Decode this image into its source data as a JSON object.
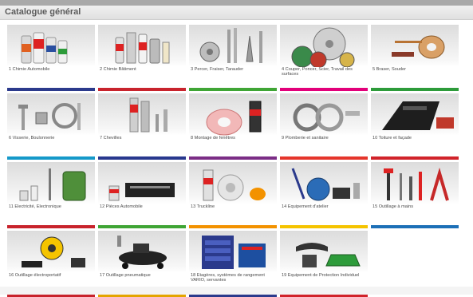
{
  "header": {
    "title": "Catalogue général"
  },
  "colors": {
    "header_bg": "#e6e6e6",
    "bars": [
      "#c62828",
      "#2e7d32",
      "#7cb342",
      "#8bc34a",
      "#e8e840",
      "#e53935",
      "#1a237e",
      "#26a69a",
      "#f9a825",
      "#fb8c00",
      "#c62828",
      "#1565c0",
      "#c62828",
      "#283593",
      "#c62828",
      "#283593",
      "#e53935",
      "#7b1fa2",
      "#1565c0"
    ]
  },
  "tiles": [
    {
      "label": "1 Chimie Automobile",
      "bar": "#2b3a8c",
      "icon": "spray-cans-icon"
    },
    {
      "label": "2 Chimie Bâtiment",
      "bar": "#c8232c",
      "icon": "cartridges-icon"
    },
    {
      "label": "3 Percer, Fraiser, Tarauder",
      "bar": "#3fa535",
      "icon": "drill-bits-icon"
    },
    {
      "label": "4 Couper, Poncer, Scier, Travail des surfaces",
      "bar": "#e2007a",
      "icon": "saw-blade-icon"
    },
    {
      "label": "5 Braser, Souder",
      "bar": "#2d9b3a",
      "icon": "solder-wire-icon"
    },
    {
      "label": "6 Visserie, Boulonnerie",
      "bar": "#1599c9",
      "icon": "screws-icon"
    },
    {
      "label": "7 Chevilles",
      "bar": "#28388e",
      "icon": "anchors-icon"
    },
    {
      "label": "8 Montage de fenêtres",
      "bar": "#7b2d86",
      "icon": "window-tape-icon"
    },
    {
      "label": "9 Plomberie et sanitaire",
      "bar": "#e5352b",
      "icon": "plumbing-hose-icon"
    },
    {
      "label": "10 Toiture et façade",
      "bar": "#d1232a",
      "icon": "roofing-icon"
    },
    {
      "label": "11 Electricité, Electronique",
      "bar": "#c8232c",
      "icon": "cable-reel-icon"
    },
    {
      "label": "12 Pièces Automobile",
      "bar": "#3fa535",
      "icon": "car-parts-icon"
    },
    {
      "label": "13 Truckline",
      "bar": "#f39200",
      "icon": "truck-parts-icon"
    },
    {
      "label": "14 Equipement d'atelier",
      "bar": "#f5c400",
      "icon": "workshop-equipment-icon"
    },
    {
      "label": "15 Outillage à mains",
      "bar": "#1d70b7",
      "icon": "hand-tools-icon"
    },
    {
      "label": "16 Outillage électroportatif",
      "bar": "#c8232c",
      "icon": "power-tools-icon"
    },
    {
      "label": "17 Outillage pneumatique",
      "bar": "#e4a500",
      "icon": "compressor-icon"
    },
    {
      "label": "18 Etagères, systèmes de rangement VARIO, servantes",
      "bar": "#2b3a8c",
      "icon": "shelving-icon"
    },
    {
      "label": "19 Equipement de Protection Individuel",
      "bar": "#d1232a",
      "icon": "protective-gear-icon"
    }
  ]
}
